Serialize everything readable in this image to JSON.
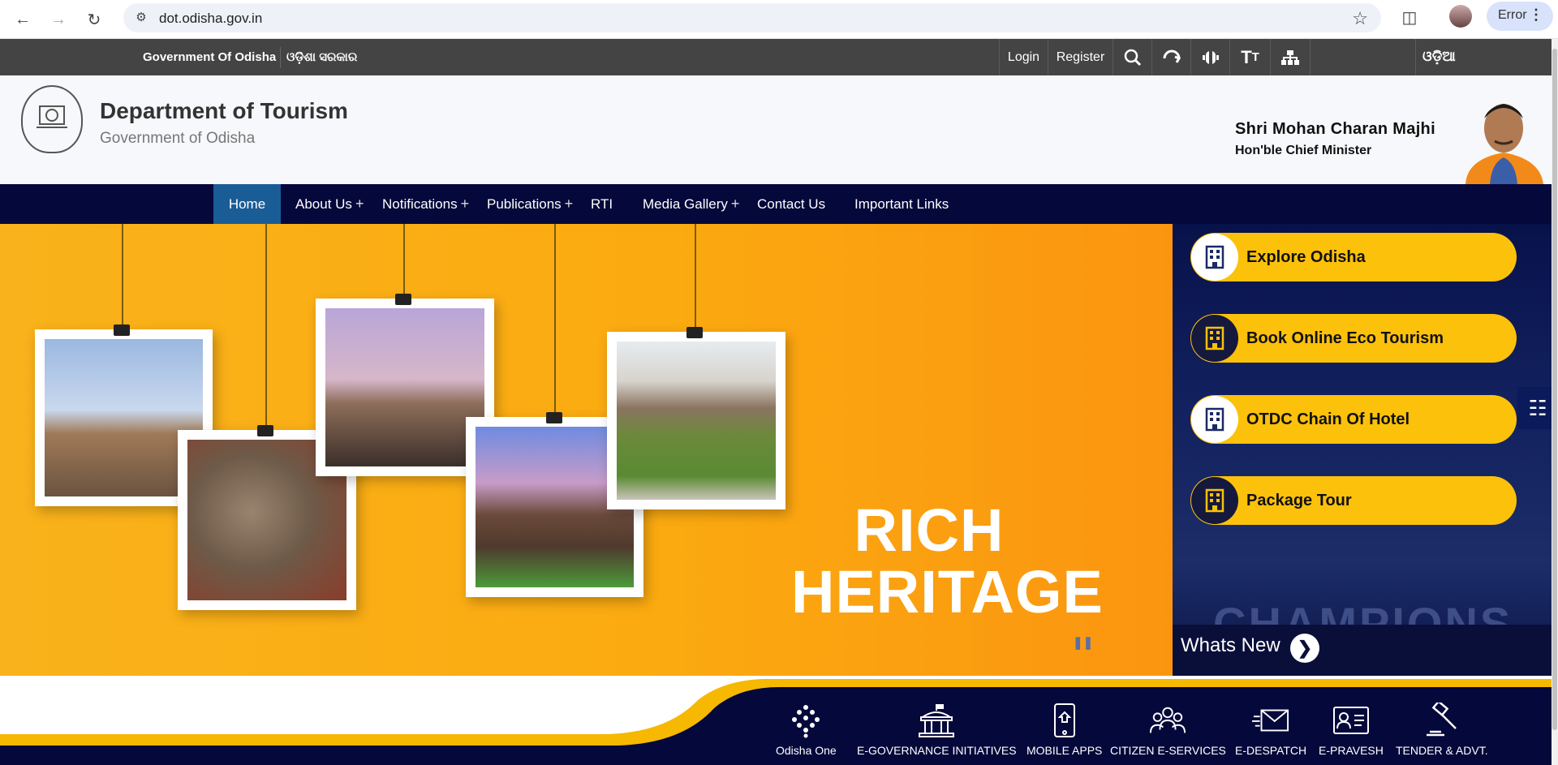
{
  "browser": {
    "url": "dot.odisha.gov.in",
    "profile_status": "Error"
  },
  "topbar": {
    "gov_en": "Government Of Odisha",
    "gov_or": "ଓଡ଼ିଶା ସରକାର",
    "login": "Login",
    "register": "Register",
    "language": "ଓଡ଼ିଆ"
  },
  "header": {
    "title": "Department of Tourism",
    "subtitle": "Government of Odisha",
    "cm_name": "Shri Mohan Charan Majhi",
    "cm_designation": "Hon'ble Chief Minister"
  },
  "nav": {
    "items": [
      {
        "label": "Home",
        "active": true
      },
      {
        "label": "About Us",
        "has_sub": true
      },
      {
        "label": "Notifications",
        "has_sub": true
      },
      {
        "label": "Publications",
        "has_sub": true
      },
      {
        "label": "RTI"
      },
      {
        "label": "Media Gallery",
        "has_sub": true
      },
      {
        "label": "Contact Us"
      },
      {
        "label": "Important Links"
      }
    ]
  },
  "banner": {
    "line1": "RICH",
    "line2": "HERITAGE"
  },
  "quick_links": [
    {
      "label": "Explore Odisha",
      "icon": "building-icon"
    },
    {
      "label": "Book Online Eco Tourism",
      "icon": "building-icon"
    },
    {
      "label": "OTDC Chain Of Hotel",
      "icon": "building-icon"
    },
    {
      "label": "Package Tour",
      "icon": "building-icon"
    }
  ],
  "right_panel": {
    "background_text": "CHAMPIONS",
    "whats_new": "Whats New"
  },
  "services": [
    {
      "label": "Odisha One",
      "icon": "odisha-one-icon"
    },
    {
      "label": "E-GOVERNANCE INITIATIVES",
      "icon": "government-building-icon"
    },
    {
      "label": "MOBILE APPS",
      "icon": "mobile-phone-icon"
    },
    {
      "label": "CITIZEN E-SERVICES",
      "icon": "people-group-icon"
    },
    {
      "label": "E-DESPATCH",
      "icon": "envelope-icon"
    },
    {
      "label": "E-PRAVESH",
      "icon": "id-card-icon"
    },
    {
      "label": "TENDER & ADVT.",
      "icon": "gavel-icon"
    }
  ],
  "colors": {
    "nav_bg": "#05083a",
    "active_tab": "#1a5c96",
    "accent_yellow": "#fcc10a",
    "banner_orange": "#fbab10",
    "topbar": "#444444"
  }
}
